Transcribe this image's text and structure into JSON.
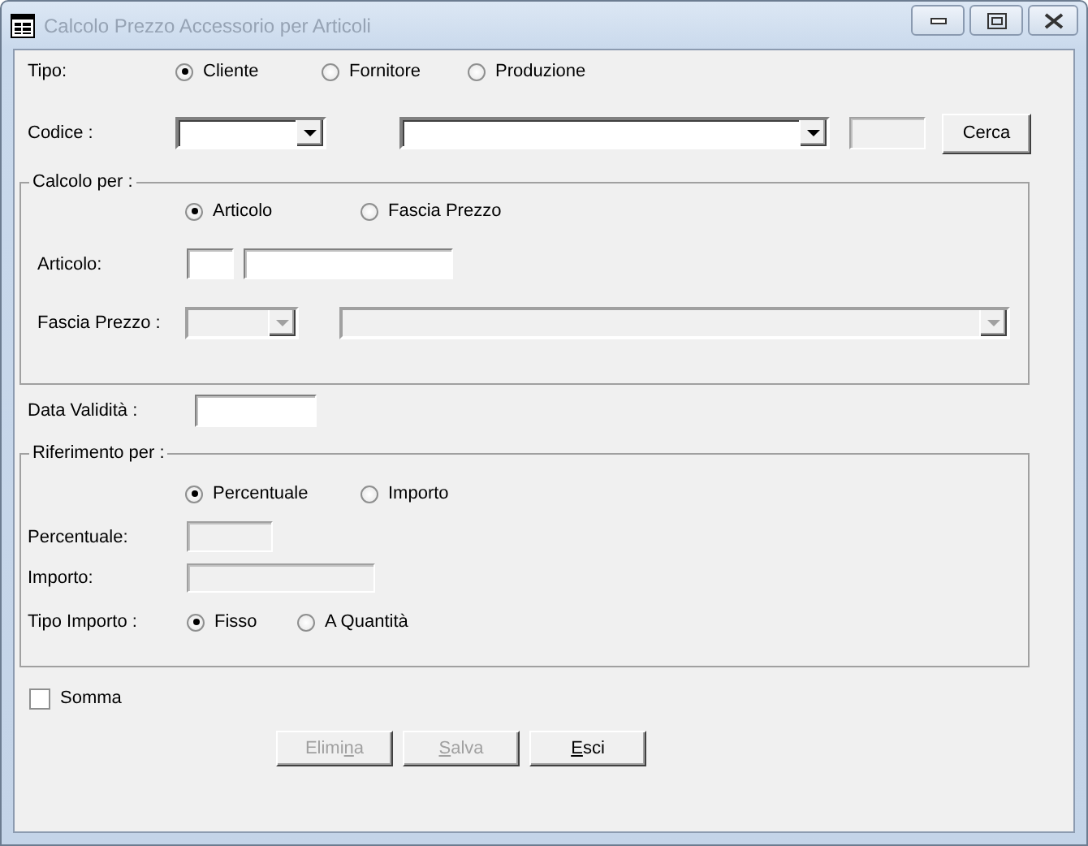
{
  "window": {
    "title": "Calcolo Prezzo Accessorio per Articoli"
  },
  "tipo": {
    "label": "Tipo:",
    "options": [
      {
        "label": "Cliente",
        "selected": true
      },
      {
        "label": "Fornitore",
        "selected": false
      },
      {
        "label": "Produzione",
        "selected": false
      }
    ]
  },
  "codice": {
    "label": "Codice :",
    "code_combo": {
      "disabled": false
    },
    "name_combo": {
      "disabled": false
    },
    "code_field": {
      "disabled": true
    },
    "search_button": {
      "label_parts": [
        {
          "text": "Cerca",
          "underlined": false
        }
      ],
      "disabled": false
    }
  },
  "calcolo_per": {
    "title": "Calcolo per :",
    "options": [
      {
        "label": "Articolo",
        "selected": true
      },
      {
        "label": "Fascia Prezzo",
        "selected": false
      }
    ],
    "articolo": {
      "label": "Articolo:",
      "code_field": {
        "disabled": false
      },
      "description_field": {
        "disabled": false
      }
    },
    "fascia_prezzo": {
      "label": "Fascia Prezzo :",
      "code_combo": {
        "disabled": true
      },
      "description_combo": {
        "disabled": true
      }
    }
  },
  "data_validita": {
    "label": "Data Validità :",
    "field": {
      "disabled": false
    }
  },
  "riferimento_per": {
    "title": "Riferimento per :",
    "options": [
      {
        "label": "Percentuale",
        "selected": true
      },
      {
        "label": "Importo",
        "selected": false
      }
    ],
    "percentuale": {
      "label": "Percentuale:",
      "field": {
        "disabled": true
      }
    },
    "importo": {
      "label": "Importo:",
      "field": {
        "disabled": true
      }
    },
    "tipo_importo": {
      "label": "Tipo Importo :",
      "options": [
        {
          "label": "Fisso",
          "selected": true
        },
        {
          "label": "A Quantità",
          "selected": false
        }
      ]
    }
  },
  "somma": {
    "label": "Somma",
    "checked": false
  },
  "buttons": [
    {
      "label_parts": [
        {
          "text": "Elimi",
          "underlined": false
        },
        {
          "text": "n",
          "underlined": true
        },
        {
          "text": "a",
          "underlined": false
        }
      ],
      "disabled": true
    },
    {
      "label_parts": [
        {
          "text": "S",
          "underlined": true
        },
        {
          "text": "alva",
          "underlined": false
        }
      ],
      "disabled": true
    },
    {
      "label_parts": [
        {
          "text": "E",
          "underlined": true
        },
        {
          "text": "sci",
          "underlined": false
        }
      ],
      "disabled": false
    }
  ]
}
